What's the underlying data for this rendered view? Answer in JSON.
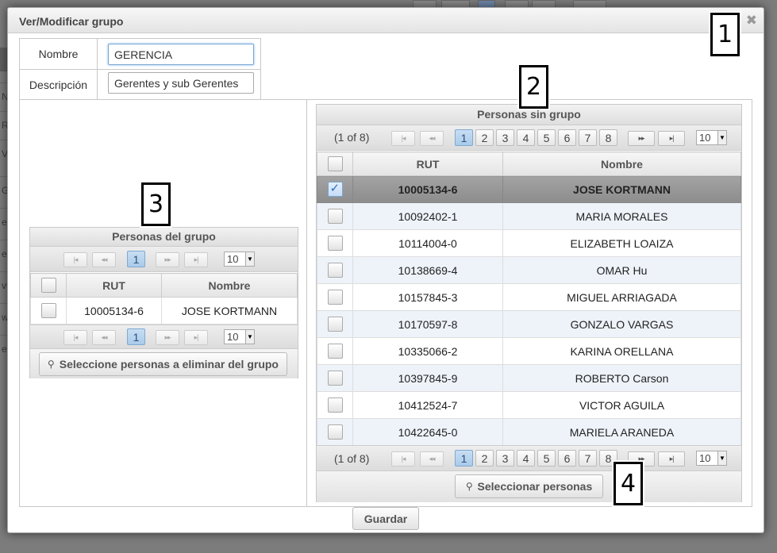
{
  "dialog": {
    "title": "Ver/Modificar grupo",
    "close_icon": "close-icon"
  },
  "callouts": [
    "1",
    "2",
    "3",
    "4"
  ],
  "form": {
    "nombre_label": "Nombre",
    "nombre_value": "GERENCIA",
    "descripcion_label": "Descripción",
    "descripcion_value": "Gerentes y sub Gerentes"
  },
  "group_panel": {
    "title": "Personas del grupo",
    "page": "1",
    "rows_per_page": "10",
    "columns": [
      "RUT",
      "Nombre"
    ],
    "rows": [
      {
        "rut": "10005134-6",
        "nombre": "JOSE KORTMANN"
      }
    ],
    "remove_button": "Seleccione personas a eliminar del grupo"
  },
  "available_panel": {
    "title": "Personas sin grupo",
    "page_info": "(1 of 8)",
    "pages": [
      "1",
      "2",
      "3",
      "4",
      "5",
      "6",
      "7",
      "8"
    ],
    "rows_per_page": "10",
    "columns": [
      "RUT",
      "Nombre"
    ],
    "rows": [
      {
        "rut": "10005134-6",
        "nombre": "JOSE KORTMANN",
        "checked": true
      },
      {
        "rut": "10092402-1",
        "nombre": "MARIA MORALES",
        "checked": false
      },
      {
        "rut": "10114004-0",
        "nombre": "ELIZABETH LOAIZA",
        "checked": false
      },
      {
        "rut": "10138669-4",
        "nombre": "OMAR Hu",
        "checked": false
      },
      {
        "rut": "10157845-3",
        "nombre": "MIGUEL ARRIAGADA",
        "checked": false
      },
      {
        "rut": "10170597-8",
        "nombre": "GONZALO VARGAS",
        "checked": false
      },
      {
        "rut": "10335066-2",
        "nombre": "KARINA ORELLANA",
        "checked": false
      },
      {
        "rut": "10397845-9",
        "nombre": "ROBERTO Carson",
        "checked": false
      },
      {
        "rut": "10412524-7",
        "nombre": "VICTOR AGUILA",
        "checked": false
      },
      {
        "rut": "10422645-0",
        "nombre": "MARIELA ARANEDA",
        "checked": false
      }
    ],
    "select_button": "Seleccionar personas"
  },
  "footer": {
    "save_button": "Guardar"
  },
  "background": {
    "row_fragments": [
      "N",
      "RI",
      "VE",
      "GI",
      "e",
      "e",
      "vty",
      "wh",
      "e"
    ]
  }
}
